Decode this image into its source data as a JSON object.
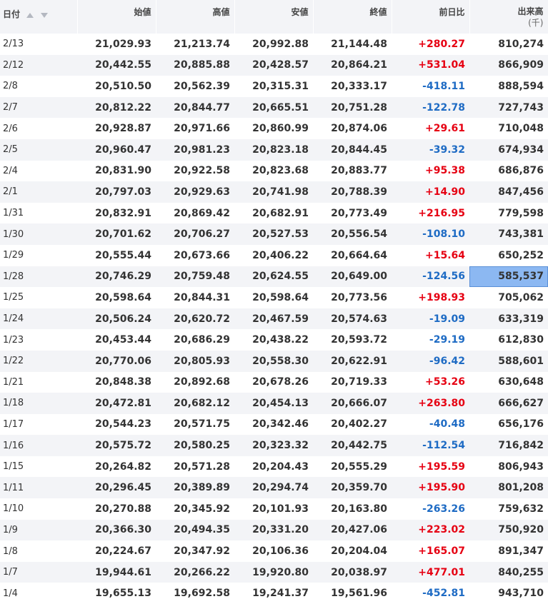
{
  "header": {
    "date": "日付",
    "open": "始値",
    "high": "高値",
    "low": "安値",
    "close": "終値",
    "change": "前日比",
    "volume": "出来高",
    "volume_unit": "(千)"
  },
  "rows": [
    {
      "date": "2/13",
      "open": "21,029.93",
      "high": "21,213.74",
      "low": "20,992.88",
      "close": "21,144.48",
      "change": "+280.27",
      "volume": "810,274"
    },
    {
      "date": "2/12",
      "open": "20,442.55",
      "high": "20,885.88",
      "low": "20,428.57",
      "close": "20,864.21",
      "change": "+531.04",
      "volume": "866,909"
    },
    {
      "date": "2/8",
      "open": "20,510.50",
      "high": "20,562.39",
      "low": "20,315.31",
      "close": "20,333.17",
      "change": "-418.11",
      "volume": "888,594"
    },
    {
      "date": "2/7",
      "open": "20,812.22",
      "high": "20,844.77",
      "low": "20,665.51",
      "close": "20,751.28",
      "change": "-122.78",
      "volume": "727,743"
    },
    {
      "date": "2/6",
      "open": "20,928.87",
      "high": "20,971.66",
      "low": "20,860.99",
      "close": "20,874.06",
      "change": "+29.61",
      "volume": "710,048"
    },
    {
      "date": "2/5",
      "open": "20,960.47",
      "high": "20,981.23",
      "low": "20,823.18",
      "close": "20,844.45",
      "change": "-39.32",
      "volume": "674,934"
    },
    {
      "date": "2/4",
      "open": "20,831.90",
      "high": "20,922.58",
      "low": "20,823.68",
      "close": "20,883.77",
      "change": "+95.38",
      "volume": "686,876"
    },
    {
      "date": "2/1",
      "open": "20,797.03",
      "high": "20,929.63",
      "low": "20,741.98",
      "close": "20,788.39",
      "change": "+14.90",
      "volume": "847,456"
    },
    {
      "date": "1/31",
      "open": "20,832.91",
      "high": "20,869.42",
      "low": "20,682.91",
      "close": "20,773.49",
      "change": "+216.95",
      "volume": "779,598"
    },
    {
      "date": "1/30",
      "open": "20,701.62",
      "high": "20,706.27",
      "low": "20,527.53",
      "close": "20,556.54",
      "change": "-108.10",
      "volume": "743,381"
    },
    {
      "date": "1/29",
      "open": "20,555.44",
      "high": "20,673.66",
      "low": "20,406.22",
      "close": "20,664.64",
      "change": "+15.64",
      "volume": "650,252"
    },
    {
      "date": "1/28",
      "open": "20,746.29",
      "high": "20,759.48",
      "low": "20,624.55",
      "close": "20,649.00",
      "change": "-124.56",
      "volume": "585,537",
      "selected": true
    },
    {
      "date": "1/25",
      "open": "20,598.64",
      "high": "20,844.31",
      "low": "20,598.64",
      "close": "20,773.56",
      "change": "+198.93",
      "volume": "705,062"
    },
    {
      "date": "1/24",
      "open": "20,506.24",
      "high": "20,620.72",
      "low": "20,467.59",
      "close": "20,574.63",
      "change": "-19.09",
      "volume": "633,319"
    },
    {
      "date": "1/23",
      "open": "20,453.44",
      "high": "20,686.29",
      "low": "20,438.22",
      "close": "20,593.72",
      "change": "-29.19",
      "volume": "612,830"
    },
    {
      "date": "1/22",
      "open": "20,770.06",
      "high": "20,805.93",
      "low": "20,558.30",
      "close": "20,622.91",
      "change": "-96.42",
      "volume": "588,601"
    },
    {
      "date": "1/21",
      "open": "20,848.38",
      "high": "20,892.68",
      "low": "20,678.26",
      "close": "20,719.33",
      "change": "+53.26",
      "volume": "630,648"
    },
    {
      "date": "1/18",
      "open": "20,472.81",
      "high": "20,682.12",
      "low": "20,454.13",
      "close": "20,666.07",
      "change": "+263.80",
      "volume": "666,627"
    },
    {
      "date": "1/17",
      "open": "20,544.23",
      "high": "20,571.75",
      "low": "20,342.46",
      "close": "20,402.27",
      "change": "-40.48",
      "volume": "656,176"
    },
    {
      "date": "1/16",
      "open": "20,575.72",
      "high": "20,580.25",
      "low": "20,323.32",
      "close": "20,442.75",
      "change": "-112.54",
      "volume": "716,842"
    },
    {
      "date": "1/15",
      "open": "20,264.82",
      "high": "20,571.28",
      "low": "20,204.43",
      "close": "20,555.29",
      "change": "+195.59",
      "volume": "806,943"
    },
    {
      "date": "1/11",
      "open": "20,296.45",
      "high": "20,389.89",
      "low": "20,294.74",
      "close": "20,359.70",
      "change": "+195.90",
      "volume": "801,208"
    },
    {
      "date": "1/10",
      "open": "20,270.88",
      "high": "20,345.92",
      "low": "20,101.93",
      "close": "20,163.80",
      "change": "-263.26",
      "volume": "759,632"
    },
    {
      "date": "1/9",
      "open": "20,366.30",
      "high": "20,494.35",
      "low": "20,331.20",
      "close": "20,427.06",
      "change": "+223.02",
      "volume": "750,920"
    },
    {
      "date": "1/8",
      "open": "20,224.67",
      "high": "20,347.92",
      "low": "20,106.36",
      "close": "20,204.04",
      "change": "+165.07",
      "volume": "891,347"
    },
    {
      "date": "1/7",
      "open": "19,944.61",
      "high": "20,266.22",
      "low": "19,920.80",
      "close": "20,038.97",
      "change": "+477.01",
      "volume": "840,255"
    },
    {
      "date": "1/4",
      "open": "19,655.13",
      "high": "19,692.58",
      "low": "19,241.37",
      "close": "19,561.96",
      "change": "-452.81",
      "volume": "943,710"
    }
  ],
  "colors": {
    "up": "#e60012",
    "down": "#1e6bc4",
    "header_bg": "#f3f4f7",
    "selected_bg": "#8cb8f2"
  },
  "icons": {
    "sort_asc": "triangle-up-icon",
    "sort_desc": "triangle-down-icon"
  }
}
